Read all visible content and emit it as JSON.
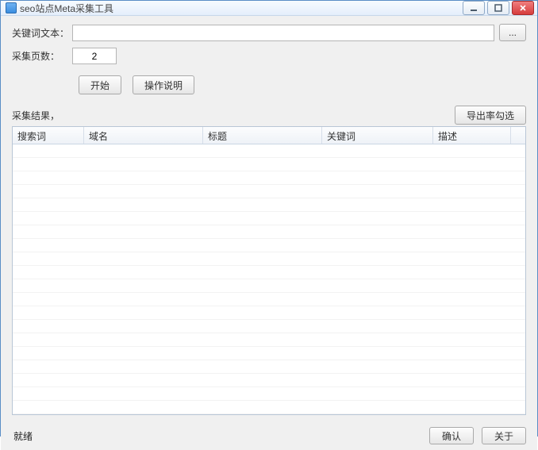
{
  "titlebar": {
    "title": "seo站点Meta采集工具"
  },
  "form": {
    "keyword_label": "关键词文本：",
    "keyword_value": "",
    "browse_label": "...",
    "pages_label": "采集页数：",
    "pages_value": "2",
    "start_label": "开始",
    "help_label": "操作说明"
  },
  "results": {
    "heading": "采集结果，",
    "export_label": "导出率勾选",
    "columns": {
      "search": "搜索词",
      "domain": "域名",
      "title": "标题",
      "keyword": "关键词",
      "desc": "描述"
    }
  },
  "footer": {
    "status": "就绪",
    "btn1": "确认",
    "btn2": "关于"
  }
}
